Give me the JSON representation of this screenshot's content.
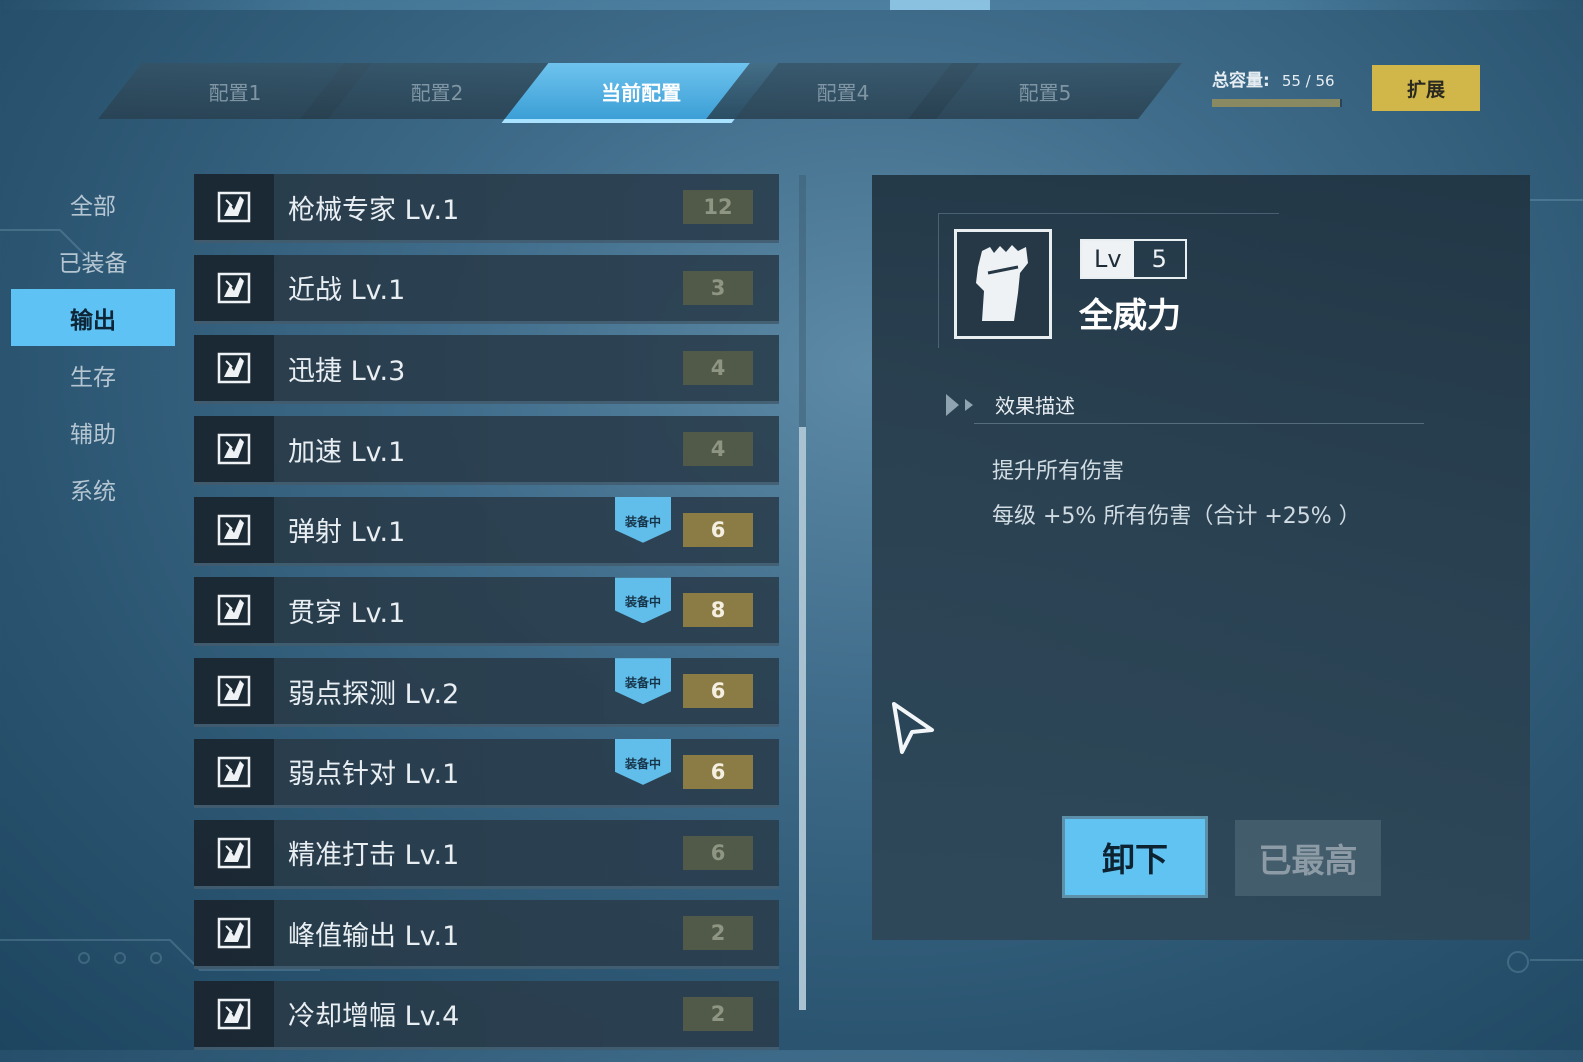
{
  "tabs": [
    {
      "label": "配置1",
      "active": false
    },
    {
      "label": "配置2",
      "active": false
    },
    {
      "label": "当前配置",
      "active": true
    },
    {
      "label": "配置4",
      "active": false
    },
    {
      "label": "配置5",
      "active": false
    }
  ],
  "capacity": {
    "label": "总容量:",
    "value": "55 / 56",
    "fraction": 0.982
  },
  "expand_label": "扩展",
  "categories": [
    {
      "label": "全部",
      "active": false
    },
    {
      "label": "已装备",
      "active": false
    },
    {
      "label": "输出",
      "active": true
    },
    {
      "label": "生存",
      "active": false
    },
    {
      "label": "辅助",
      "active": false
    },
    {
      "label": "系统",
      "active": false
    }
  ],
  "skills": [
    {
      "name": "枪械专家 Lv.1",
      "cost": "12",
      "equipped": false
    },
    {
      "name": "近战 Lv.1",
      "cost": "3",
      "equipped": false
    },
    {
      "name": "迅捷 Lv.3",
      "cost": "4",
      "equipped": false
    },
    {
      "name": "加速 Lv.1",
      "cost": "4",
      "equipped": false
    },
    {
      "name": "弹射 Lv.1",
      "cost": "6",
      "equipped": true
    },
    {
      "name": "贯穿 Lv.1",
      "cost": "8",
      "equipped": true
    },
    {
      "name": "弱点探测 Lv.2",
      "cost": "6",
      "equipped": true
    },
    {
      "name": "弱点针对 Lv.1",
      "cost": "6",
      "equipped": true
    },
    {
      "name": "精准打击 Lv.1",
      "cost": "6",
      "equipped": false
    },
    {
      "name": "峰值输出 Lv.1",
      "cost": "2",
      "equipped": false
    },
    {
      "name": "冷却增幅 Lv.4",
      "cost": "2",
      "equipped": false
    }
  ],
  "equipped_badge": "装备中",
  "detail": {
    "lv_label": "Lv",
    "level": "5",
    "name": "全威力",
    "section_title": "效果描述",
    "desc_line1": "提升所有伤害",
    "desc_line2": "每级 +5% 所有伤害（合计 +25% ）"
  },
  "buttons": {
    "unequip": "卸下",
    "maxed": "已最高"
  },
  "colors": {
    "accent": "#60c3f2",
    "gold": "#d1b64a",
    "equipped_cost": "#8b7b45"
  }
}
